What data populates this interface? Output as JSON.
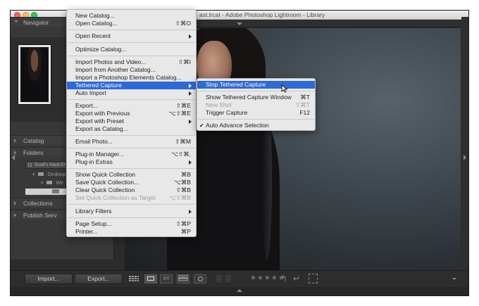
{
  "window": {
    "title": "ast.lrcat - Adobe Photoshop Lightroom - Library"
  },
  "left_panel": {
    "navigator": "Navigator",
    "catalog": "Catalog",
    "folders": "Folders",
    "volume": "Scott's Hard Dr",
    "folder_rows": [
      "Desktop",
      "We"
    ],
    "collections": "Collections",
    "publish": "Publish Serv"
  },
  "bottom": {
    "import_label": "Import...",
    "export_label": "Export...",
    "stars": "★★★★★"
  },
  "file_menu": {
    "items": [
      {
        "label": "New Catalog...",
        "shortcut": ""
      },
      {
        "label": "Open Catalog...",
        "shortcut": "⇧⌘O"
      },
      {
        "label": "Open Recent",
        "shortcut": ""
      },
      {
        "label": "Optimize Catalog...",
        "shortcut": ""
      },
      {
        "label": "Import Photos and Video...",
        "shortcut": "⇧⌘I"
      },
      {
        "label": "Import from Another Catalog...",
        "shortcut": ""
      },
      {
        "label": "Import a Photoshop Elements Catalog...",
        "shortcut": ""
      },
      {
        "label": "Tethered Capture",
        "shortcut": ""
      },
      {
        "label": "Auto Import",
        "shortcut": ""
      },
      {
        "label": "Export...",
        "shortcut": "⇧⌘E"
      },
      {
        "label": "Export with Previous",
        "shortcut": "⌥⇧⌘E"
      },
      {
        "label": "Export with Preset",
        "shortcut": ""
      },
      {
        "label": "Export as Catalog...",
        "shortcut": ""
      },
      {
        "label": "Email Photo...",
        "shortcut": "⇧⌘M"
      },
      {
        "label": "Plug-in Manager...",
        "shortcut": "⌥⇧⌘,"
      },
      {
        "label": "Plug-in Extras",
        "shortcut": ""
      },
      {
        "label": "Show Quick Collection",
        "shortcut": "⌘B"
      },
      {
        "label": "Save Quick Collection...",
        "shortcut": "⌥⌘B"
      },
      {
        "label": "Clear Quick Collection",
        "shortcut": "⇧⌘B"
      },
      {
        "label": "Set Quick Collection as Target",
        "shortcut": "⌥⇧⌘B"
      },
      {
        "label": "Library Filters",
        "shortcut": ""
      },
      {
        "label": "Page Setup...",
        "shortcut": "⇧⌘P"
      },
      {
        "label": "Printer...",
        "shortcut": "⌘P"
      }
    ]
  },
  "tether_menu": {
    "items": [
      {
        "label": "Stop Tethered Capture",
        "shortcut": ""
      },
      {
        "label": "Show Tethered Capture Window",
        "shortcut": "⌘T"
      },
      {
        "label": "New Shot",
        "shortcut": "⇧⌘T"
      },
      {
        "label": "Trigger Capture",
        "shortcut": "F12"
      },
      {
        "label": "Auto Advance Selection",
        "shortcut": ""
      }
    ],
    "checkmark": "✔"
  },
  "colors": {
    "menu_highlight": "#2d6ad6",
    "menu_bg": "#e8e8e8",
    "app_bg": "#2b2b2b"
  }
}
